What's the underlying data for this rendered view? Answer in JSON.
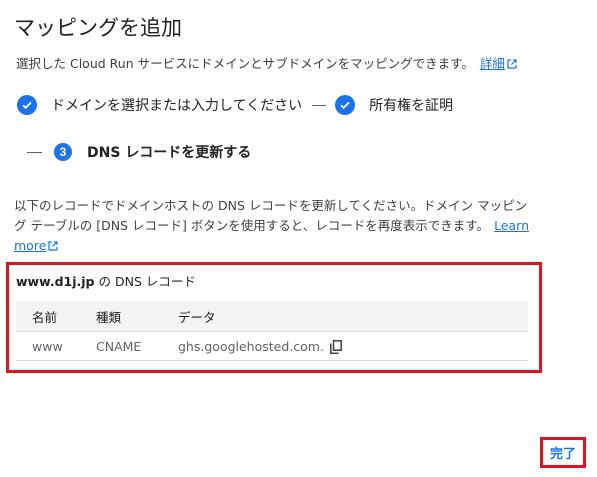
{
  "dialog": {
    "title": "マッピングを追加",
    "subtitle": "選択した Cloud Run サービスにドメインとサブドメインをマッピングできます。",
    "details_link": "詳細"
  },
  "stepper": {
    "step1_label": "ドメインを選択または入力してください",
    "step2_label": "所有権を証明",
    "step3_number": "3",
    "step3_label": "DNS レコードを更新する"
  },
  "description": {
    "text": "以下のレコードでドメインホストの DNS レコードを更新してください。ドメイン マッピング テーブルの [DNS レコード] ボタンを使用すると、レコードを再度表示できます。",
    "learn_more": "Learn more"
  },
  "records": {
    "domain": "www.d1j.jp",
    "title_suffix": " の DNS レコード",
    "headers": [
      "名前",
      "種類",
      "データ"
    ],
    "rows": [
      {
        "name": "www",
        "type": "CNAME",
        "data": "ghs.googlehosted.com."
      }
    ]
  },
  "footer": {
    "done_label": "完了"
  },
  "colors": {
    "accent": "#1a73e8",
    "highlight": "#e0141e",
    "header_bg": "#f1f3f4"
  }
}
